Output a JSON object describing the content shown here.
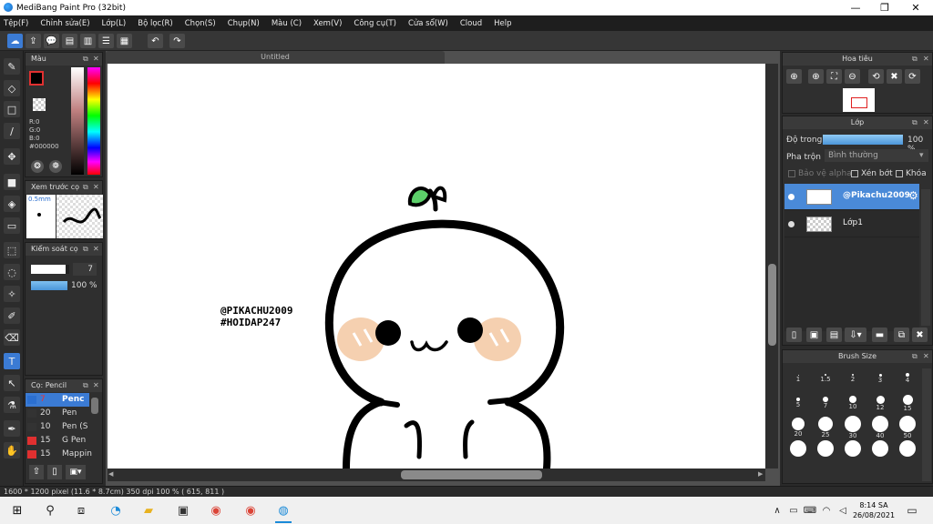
{
  "app": {
    "title": "MediBang Paint Pro (32bit)"
  },
  "window_controls": {
    "minimize": "—",
    "maximize": "❐",
    "close": "✕"
  },
  "menu": [
    "Tệp(F)",
    "Chỉnh sửa(E)",
    "Lớp(L)",
    "Bộ lọc(R)",
    "Chọn(S)",
    "Chụp(N)",
    "Màu (C)",
    "Xem(V)",
    "Công cụ(T)",
    "Cửa sổ(W)",
    "Cloud",
    "Help"
  ],
  "color_panel": {
    "title": "Màu",
    "r": "R:0",
    "g": "G:0",
    "b": "B:0",
    "hex": "#000000"
  },
  "preview_panel": {
    "title": "Xem trước cọ",
    "size": "0.5mm"
  },
  "control_panel": {
    "title": "Kiểm soát cọ",
    "size_value": "7",
    "opacity_value": "100 %",
    "size_fraction": 0.9,
    "opacity_fraction": 1.0
  },
  "brush_list": {
    "title": "Cọ: Pencil",
    "items": [
      {
        "size": "7",
        "name": "Penc",
        "color": "#2b6fd0",
        "selected": true
      },
      {
        "size": "20",
        "name": "Pen",
        "color": "#333333",
        "selected": false
      },
      {
        "size": "10",
        "name": "Pen (S",
        "color": "#333333",
        "selected": false
      },
      {
        "size": "15",
        "name": "G Pen",
        "color": "#e03030",
        "selected": false
      },
      {
        "size": "15",
        "name": "Mappin",
        "color": "#e03030",
        "selected": false
      }
    ]
  },
  "document": {
    "tab": "Untitled",
    "watermark_line1": "@PIKACHU2009",
    "watermark_line2": "#HOIDAP247"
  },
  "navigator": {
    "title": "Hoa tiêu"
  },
  "layer_panel": {
    "title": "Lớp",
    "opacity_label": "Độ trong",
    "opacity_value": "100 %",
    "opacity_fraction": 1.0,
    "blend_label": "Pha trộn",
    "blend_value": "Bình thường",
    "protect_alpha": "Bảo vệ alpha",
    "clipping": "Xén bớt",
    "lock": "Khóa",
    "layers": [
      {
        "name": "@Pikachu2009",
        "selected": true
      },
      {
        "name": "Lớp1",
        "selected": false
      }
    ]
  },
  "brush_size_panel": {
    "title": "Brush Size",
    "sizes": [
      "1",
      "1.5",
      "2",
      "3",
      "4",
      "5",
      "7",
      "10",
      "12",
      "15",
      "20",
      "25",
      "30",
      "40",
      "50"
    ]
  },
  "status": {
    "text": "1600 * 1200 pixel   (11.6 * 8.7cm)   350 dpi   100 %   ( 615, 811 )"
  },
  "taskbar": {
    "time": "8:14 SA",
    "date": "26/08/2021"
  },
  "colors": {
    "accent": "#3b7bd4",
    "leaf": "#5cd06a",
    "blush": "#f5d0b0"
  }
}
